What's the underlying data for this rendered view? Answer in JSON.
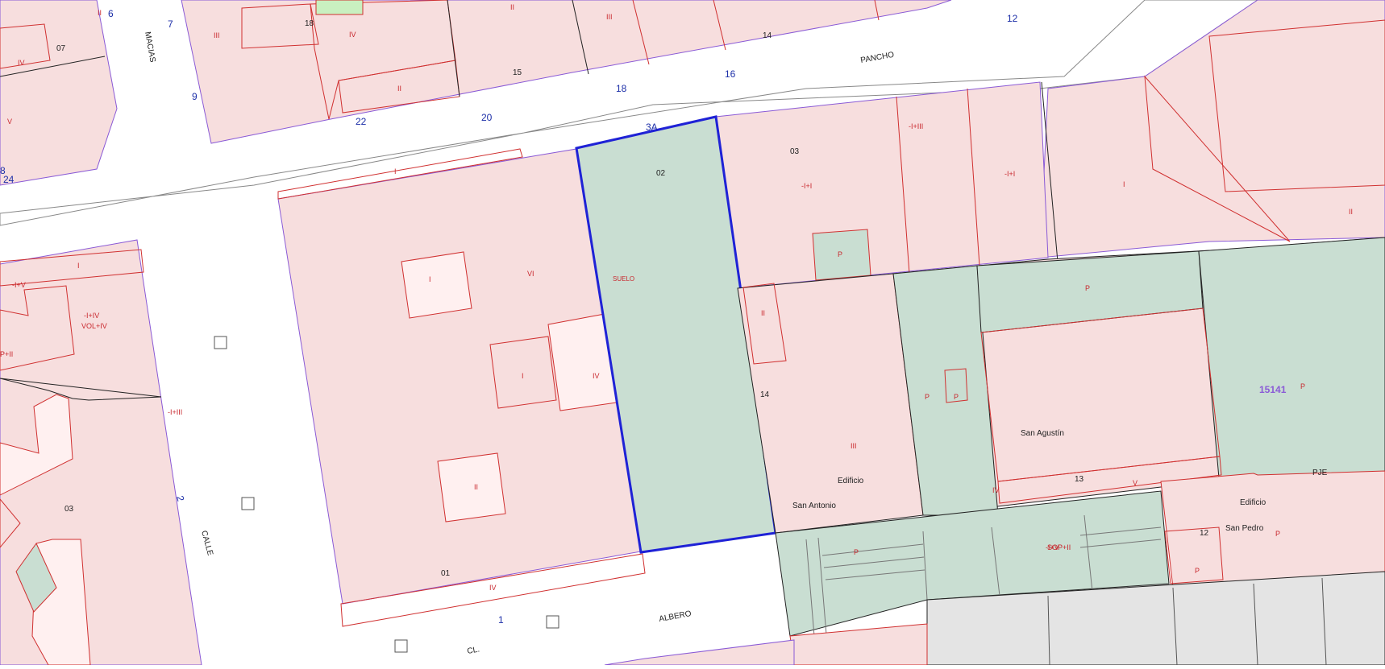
{
  "map": {
    "parcel_label": "15141",
    "subject_parcel_number": "02",
    "streets": [
      {
        "text": "MACIAS"
      },
      {
        "text": "PANCHO"
      },
      {
        "text": "CALLE"
      },
      {
        "text": "ALBERO"
      },
      {
        "text": "CL."
      },
      {
        "text": "PJE"
      }
    ],
    "house_numbers": [
      "7",
      "9",
      "6",
      "22",
      "20",
      "18",
      "16",
      "12",
      "3A",
      "1",
      "2",
      "24",
      "8"
    ],
    "parcel_numbers": [
      "07",
      "18",
      "15",
      "14",
      "03",
      "02",
      "01",
      "03",
      "14",
      "13",
      "12"
    ],
    "floor_codes": [
      "II",
      "III",
      "IV",
      "II",
      "III",
      "II",
      "IV",
      "V",
      "I",
      "VI",
      "I",
      "I",
      "IV",
      "II",
      "IV",
      "II",
      "III",
      "IV",
      "V",
      "P",
      "P",
      "P",
      "P",
      "P",
      "P",
      "P",
      "P",
      "SOP+II",
      "-I+V",
      "-I+V",
      "-I+IV",
      "VOL+IV",
      "P+II",
      "-I+III",
      "-I+III",
      "-I+I",
      "-I+I",
      "I",
      "II",
      "I"
    ],
    "land_label": "SUELO",
    "place_names": [
      "San Agustín",
      "Edificio",
      "San Antonio",
      "Edificio",
      "San Pedro"
    ]
  },
  "colors": {
    "built": "#f7dede",
    "land": "#c9ded2",
    "grey": "#e4e4e4",
    "outline_red": "#d03030",
    "boundary_purple": "#8a5ad6",
    "subject_blue": "#1f22d6"
  }
}
